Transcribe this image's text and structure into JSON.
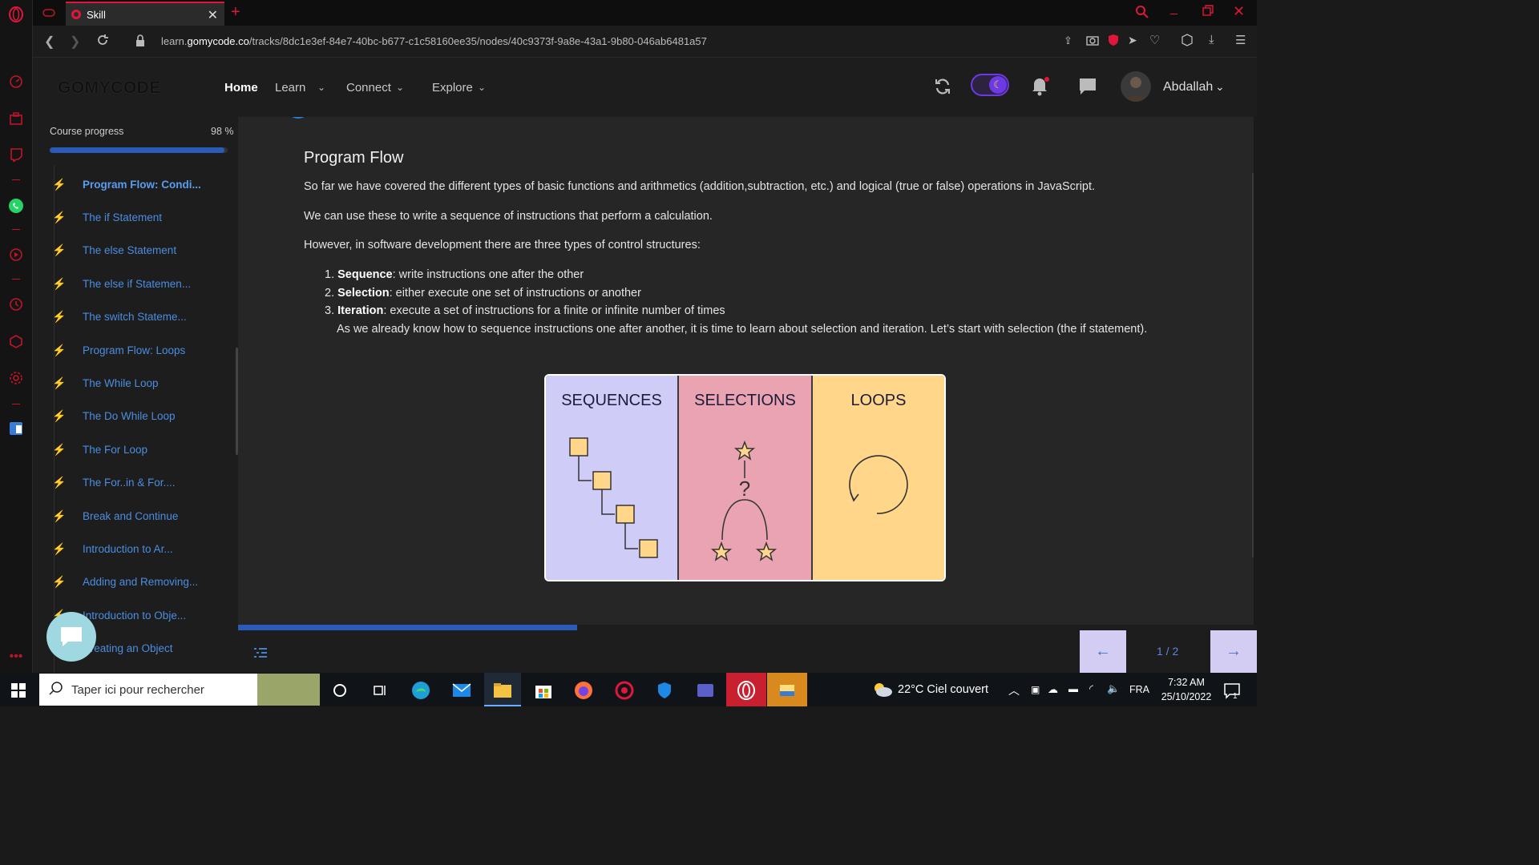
{
  "browser": {
    "tab_title": "Skill",
    "url_prefix": "learn.",
    "url_domain": "gomycode.co",
    "url_path": "/tracks/8dc1e3ef-84e7-40bc-b677-c1c58160ee35/nodes/40c9373f-9a8e-43a1-9b80-046ab6481a57",
    "accent": "#e0163a"
  },
  "site": {
    "logo": "GOMYCODE",
    "nav": {
      "home": "Home",
      "learn": "Learn",
      "connect": "Connect",
      "explore": "Explore"
    },
    "user_name": "Abdallah",
    "theme_toggle_color": "#6b39e6"
  },
  "course": {
    "progress_label": "Course progress",
    "progress_value": "98 %",
    "progress_fraction": 0.98,
    "lessons": [
      {
        "label": "Program Flow: Condi...",
        "active": true
      },
      {
        "label": "The if Statement"
      },
      {
        "label": "The else Statement"
      },
      {
        "label": "The else if Statemen..."
      },
      {
        "label": "The switch Stateme..."
      },
      {
        "label": "Program Flow: Loops"
      },
      {
        "label": "The While Loop"
      },
      {
        "label": "The Do While Loop"
      },
      {
        "label": "The For Loop"
      },
      {
        "label": "The For..in & For...."
      },
      {
        "label": "Break and Continue"
      },
      {
        "label": "Introduction to Ar..."
      },
      {
        "label": "Adding and Removing..."
      },
      {
        "label": "Introduction to Obje..."
      },
      {
        "label": "Creating an Object"
      }
    ]
  },
  "lesson": {
    "title": "Program Flow",
    "p1": "So far we have covered the different types of basic functions and arithmetics (addition,subtraction, etc.) and logical (true or false) operations in JavaScript.",
    "p2": "We can use these to write a sequence of instructions that perform a calculation.",
    "p3": "However, in software development there are three types of control structures:",
    "list": [
      {
        "num": "1.",
        "term": "Sequence",
        "desc": ": write instructions one after the other"
      },
      {
        "num": "2.",
        "term": "Selection",
        "desc": ": either execute one set of instructions or another"
      },
      {
        "num": "3.",
        "term": "Iteration",
        "desc": ": execute a set of instructions for a finite or infinite number of times"
      }
    ],
    "p4": "As we already know how to sequence instructions one after another, it is time to learn about selection and iteration. Let’s start with selection (the if statement).",
    "diagram": {
      "panels": [
        {
          "label": "SEQUENCES",
          "color": "#cfcdf7"
        },
        {
          "label": "SELECTIONS",
          "color": "#eaa3b1"
        },
        {
          "label": "LOOPS",
          "color": "#ffd68a"
        }
      ],
      "question_mark": "?"
    }
  },
  "pager": {
    "page": "1 / 2",
    "page_fraction": 0.5,
    "prev_icon": "arrow-left-icon",
    "next_icon": "arrow-right-icon"
  },
  "taskbar": {
    "search_placeholder": "Taper ici pour rechercher",
    "weather": "22°C  Ciel couvert",
    "lang": "FRA",
    "time": "7:32 AM",
    "date": "25/10/2022",
    "notif_count": "1"
  }
}
